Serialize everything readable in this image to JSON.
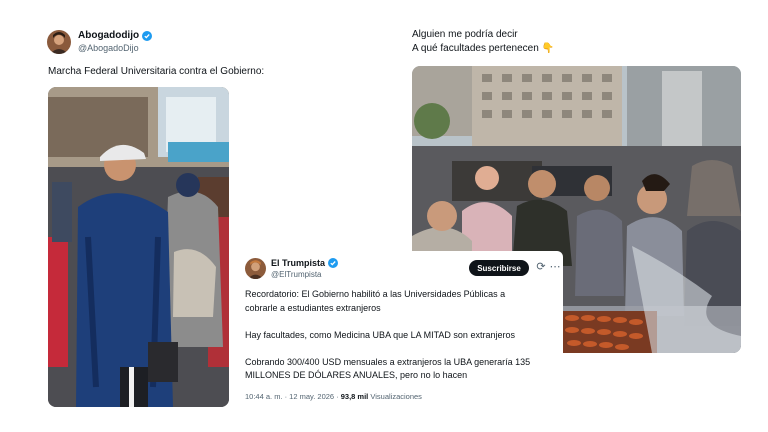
{
  "tweet_left": {
    "author_name": "Abogadodijo",
    "author_handle": "@AbogadoDijo",
    "text": "Marcha Federal Universitaria contra el Gobierno:"
  },
  "tweet_right": {
    "line1": "Alguien me podría decir",
    "line2": "A qué facultades pertenecen 👇"
  },
  "tweet_embed": {
    "author_name": "El Trumpista",
    "author_handle": "@ElTrumpista",
    "subscribe_label": "Suscribirse",
    "refresh_icon": "⟳",
    "more_icon": "⋯",
    "line1": "Recordatorio: El Gobierno habilitó a las Universidades Públicas a",
    "line2": "cobrarle a estudiantes extranjeros",
    "line3": "Hay facultades, como Medicina UBA que LA MITAD son extranjeros",
    "line4": "Cobrando 300/400 USD mensuales a extranjeros la UBA generaría 135",
    "line5": "MILLONES DE DÓLARES ANUALES, pero no lo hacen",
    "time": "10:44 a. m. · 12 may. 2026 · ",
    "views_count": "93,8 mil",
    "views_label": " Visualizaciones"
  },
  "colors": {
    "verified": "#1d9bf0",
    "text": "#0f1419",
    "muted": "#536471"
  }
}
